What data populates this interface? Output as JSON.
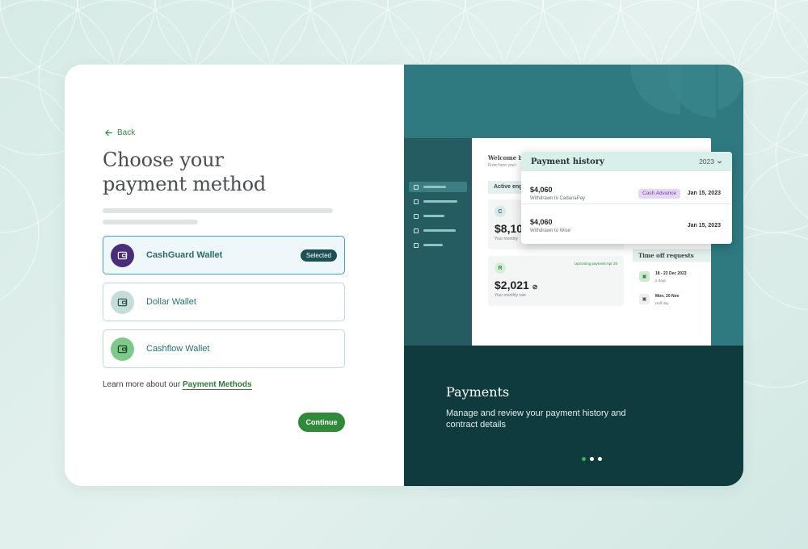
{
  "colors": {
    "accent_green": "#2f8a3a",
    "teal": "#2e7a80",
    "dark_teal": "#0f3b3e",
    "selected_badge": "#1e4f54",
    "cashguard_icon_bg": "#4a2d7a",
    "dollar_icon_bg": "#c4ddd9",
    "cashflow_icon_bg": "#7cc98a"
  },
  "left": {
    "back_label": "Back",
    "title_line1": "Choose your",
    "title_line2": "payment method",
    "options": [
      {
        "name": "CashGuard Wallet",
        "icon": "wallet-icon",
        "selected": true,
        "badge": "Selected"
      },
      {
        "name": "Dollar Wallet",
        "icon": "wallet-icon",
        "selected": false
      },
      {
        "name": "Cashflow Wallet",
        "icon": "wallet-icon",
        "selected": false
      }
    ],
    "learn_more_text": "Learn more about our",
    "learn_more_link": "Payment Methods",
    "continue_label": "Continue"
  },
  "right": {
    "carousel_title": "Payments",
    "carousel_desc": "Manage and review your payment history and contract details",
    "carousel_active_index": 0,
    "carousel_count": 3,
    "dashboard": {
      "welcome": "Welcome ba",
      "welcome_sub": "From here you'r",
      "active_engagements": "Active eng",
      "card1_initial": "C",
      "card1_amount": "$8,10",
      "card1_sub": "Your monthly",
      "card2_initial": "R",
      "card2_amount": "$2,021",
      "card2_sub": "Your monthly rate",
      "card2_upcoming": "Upcoming payment Apr 28",
      "time_off_title": "Time off requests",
      "time_off": [
        {
          "date": "18 - 23 Dec 2023",
          "sub": "5 days"
        },
        {
          "date": "Mon, 20 Nov",
          "sub": "Half day"
        }
      ]
    },
    "history": {
      "title": "Payment history",
      "year": "2023",
      "rows": [
        {
          "amount": "$4,060",
          "desc": "Withdrawn to CadanaPay",
          "tag": "Cash Advance",
          "date": "Jan 15, 2023"
        },
        {
          "amount": "$4,060",
          "desc": "Withdrawn to Wise",
          "tag": "",
          "date": "Jan 15, 2023"
        }
      ]
    }
  }
}
